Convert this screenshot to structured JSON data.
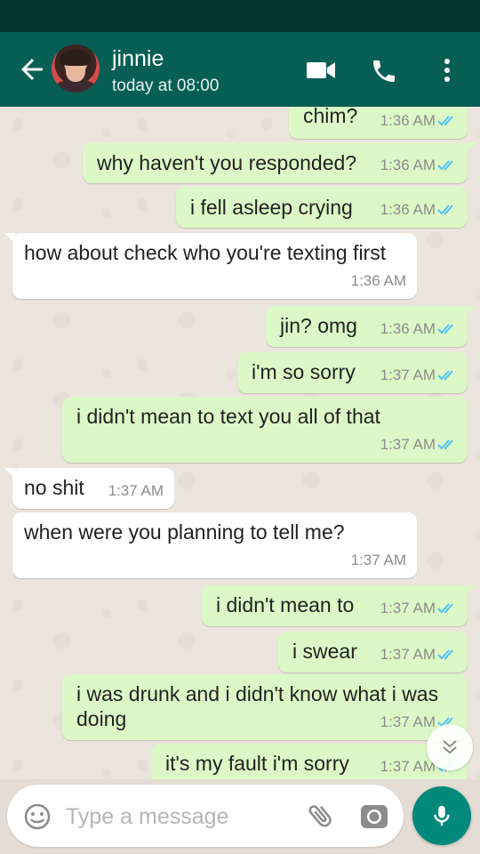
{
  "header": {
    "contact_name": "jinnie",
    "last_seen": "today at 08:00"
  },
  "icons": {
    "back": "back-arrow-icon",
    "video": "video-camera-icon",
    "call": "phone-icon",
    "menu": "more-vertical-icon",
    "emoji": "emoji-icon",
    "attach": "paperclip-icon",
    "camera": "camera-icon",
    "mic": "microphone-icon",
    "scroll": "double-chevron-down-icon"
  },
  "colors": {
    "header": "#075e54",
    "outgoing_bubble": "#dcf8c6",
    "incoming_bubble": "#ffffff",
    "read_ticks": "#4fc3f7",
    "mic_button": "#00897b"
  },
  "messages": [
    {
      "dir": "out",
      "text": "chim?",
      "time": "1:36 AM"
    },
    {
      "dir": "out",
      "text": "why haven't you responded?",
      "time": "1:36 AM"
    },
    {
      "dir": "out",
      "text": "i fell asleep crying",
      "time": "1:36 AM"
    },
    {
      "dir": "in",
      "text": "how about check who you're texting first",
      "time": "1:36 AM"
    },
    {
      "dir": "out",
      "text": "jin? omg",
      "time": "1:36 AM"
    },
    {
      "dir": "out",
      "text": "i'm so sorry",
      "time": "1:37 AM"
    },
    {
      "dir": "out",
      "text": "i didn't mean to text you all of that",
      "time": "1:37 AM"
    },
    {
      "dir": "in",
      "text": "no shit",
      "time": "1:37 AM"
    },
    {
      "dir": "in",
      "text": "when were you planning to tell me?",
      "time": "1:37 AM"
    },
    {
      "dir": "out",
      "text": "i didn't mean to",
      "time": "1:37 AM"
    },
    {
      "dir": "out",
      "text": "i swear",
      "time": "1:37 AM"
    },
    {
      "dir": "out",
      "text": "i was drunk and i didn't know what i was doing",
      "time": "1:37 AM"
    },
    {
      "dir": "out",
      "text": "it's my fault i'm sorry",
      "time": "1:37 AM"
    }
  ],
  "composer": {
    "placeholder": "Type a message"
  }
}
